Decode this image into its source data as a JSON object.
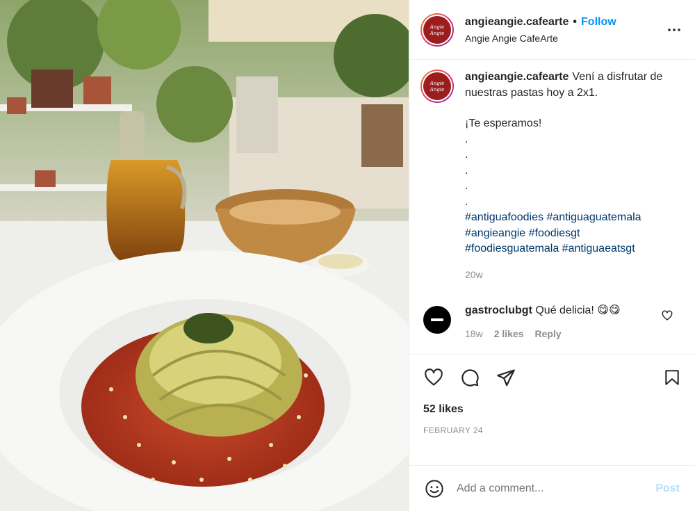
{
  "post": {
    "username": "angieangie.cafearte",
    "dot": "•",
    "follow_label": "Follow",
    "location": "Angie Angie CafeArte",
    "more_icon": "more-horizontal-icon",
    "avatar_text": "Angie Angie"
  },
  "caption": {
    "username": "angieangie.cafearte",
    "line1": "Vení a disfrutar de nuestras pastas hoy a 2x1.",
    "line2": "¡Te esperamos!",
    "dots": [
      ".",
      ".",
      ".",
      ".",
      "."
    ],
    "hashtags": [
      "#antiguafoodies",
      "#antiguaguatemala",
      "#angieangie",
      "#foodiesgt",
      "#foodiesguatemala",
      "#antiguaeatsgt"
    ],
    "time": "20w"
  },
  "comment": {
    "username": "gastroclubgt",
    "text": "Qué delicia! 😋😋",
    "time": "18w",
    "likes": "2 likes",
    "reply": "Reply"
  },
  "actions": {
    "likes": "52 likes",
    "date": "FEBRUARY 24"
  },
  "add_comment": {
    "placeholder": "Add a comment...",
    "post_label": "Post"
  },
  "colors": {
    "link": "#0095f6",
    "hashtag": "#00376b",
    "muted": "#8e8e8e",
    "post_disabled": "#b2dffc"
  }
}
